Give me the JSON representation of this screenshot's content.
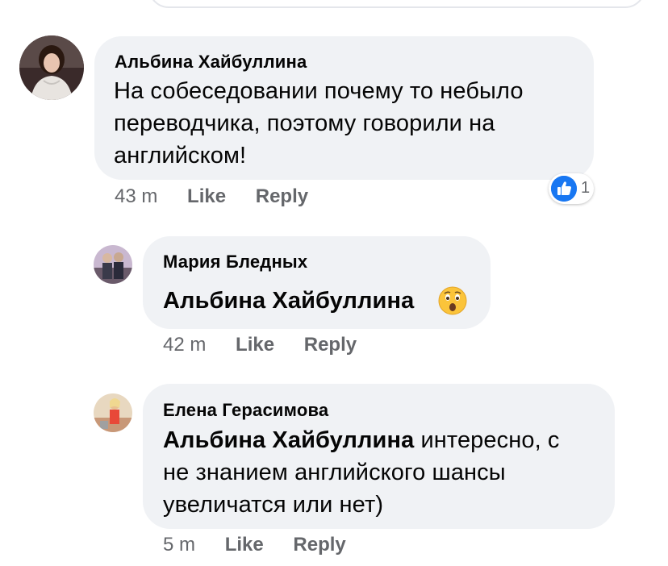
{
  "comments": [
    {
      "author": "Альбина Хайбуллина",
      "lines": [
        "На собеседовании почему то небыло",
        "переводчика, поэтому говорили на",
        "английском!"
      ],
      "time": "43 m",
      "like": "Like",
      "reply": "Reply",
      "reaction_count": "1",
      "reaction_icon": "thumbs-up-icon"
    },
    {
      "author": "Мария Бледных",
      "mention": "Альбина Хайбуллина",
      "emoji": "astonished-face-emoji",
      "time": "42 m",
      "like": "Like",
      "reply": "Reply"
    },
    {
      "author": "Елена Герасимова",
      "mention": "Альбина Хайбуллина",
      "line1_rest": " интересно, с",
      "line2": "не знанием английского шансы",
      "line3": "увеличатся или нет)",
      "time": "5 m",
      "like": "Like",
      "reply": "Reply"
    }
  ],
  "colors": {
    "bubble": "#f0f2f5",
    "meta": "#65676b",
    "like_blue": "#1877f2",
    "text": "#050505"
  }
}
